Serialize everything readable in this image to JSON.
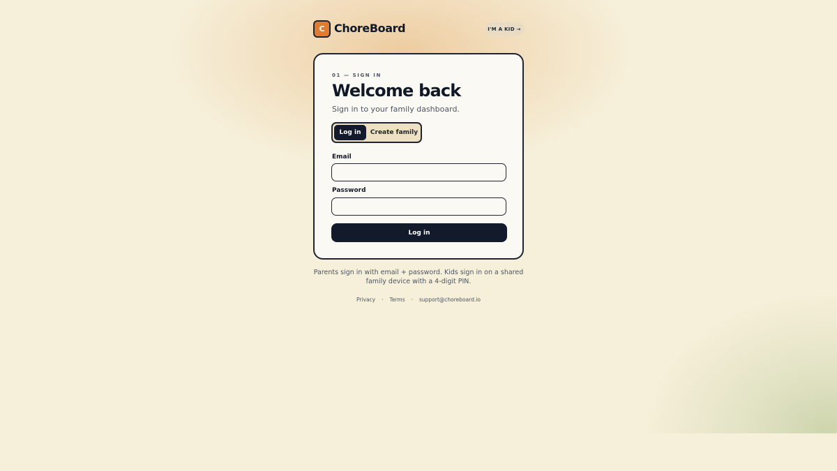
{
  "brand": {
    "logo_letter": "C",
    "name": "ChoreBoard",
    "kid_button": "I'M A KID →"
  },
  "card": {
    "eyebrow": "01 — SIGN IN",
    "title": "Welcome back",
    "subtitle": "Sign in to your family dashboard.",
    "tabs": [
      {
        "label": "Log in",
        "active": true
      },
      {
        "label": "Create family",
        "active": false
      }
    ],
    "email": {
      "label": "Email",
      "value": "",
      "placeholder": ""
    },
    "password": {
      "label": "Password",
      "value": "",
      "placeholder": ""
    },
    "submit_label": "Log in"
  },
  "note": "Parents sign in with email + password. Kids sign in on a shared family device with a 4-digit PIN.",
  "footer": {
    "links": [
      "Privacy",
      "Terms",
      "support@choreboard.io"
    ],
    "separator": "·"
  },
  "colors": {
    "accent": "#e07b32",
    "ink": "#131a2b",
    "card_bg": "#fbf9f3",
    "page_bg": "#f6efd9"
  }
}
